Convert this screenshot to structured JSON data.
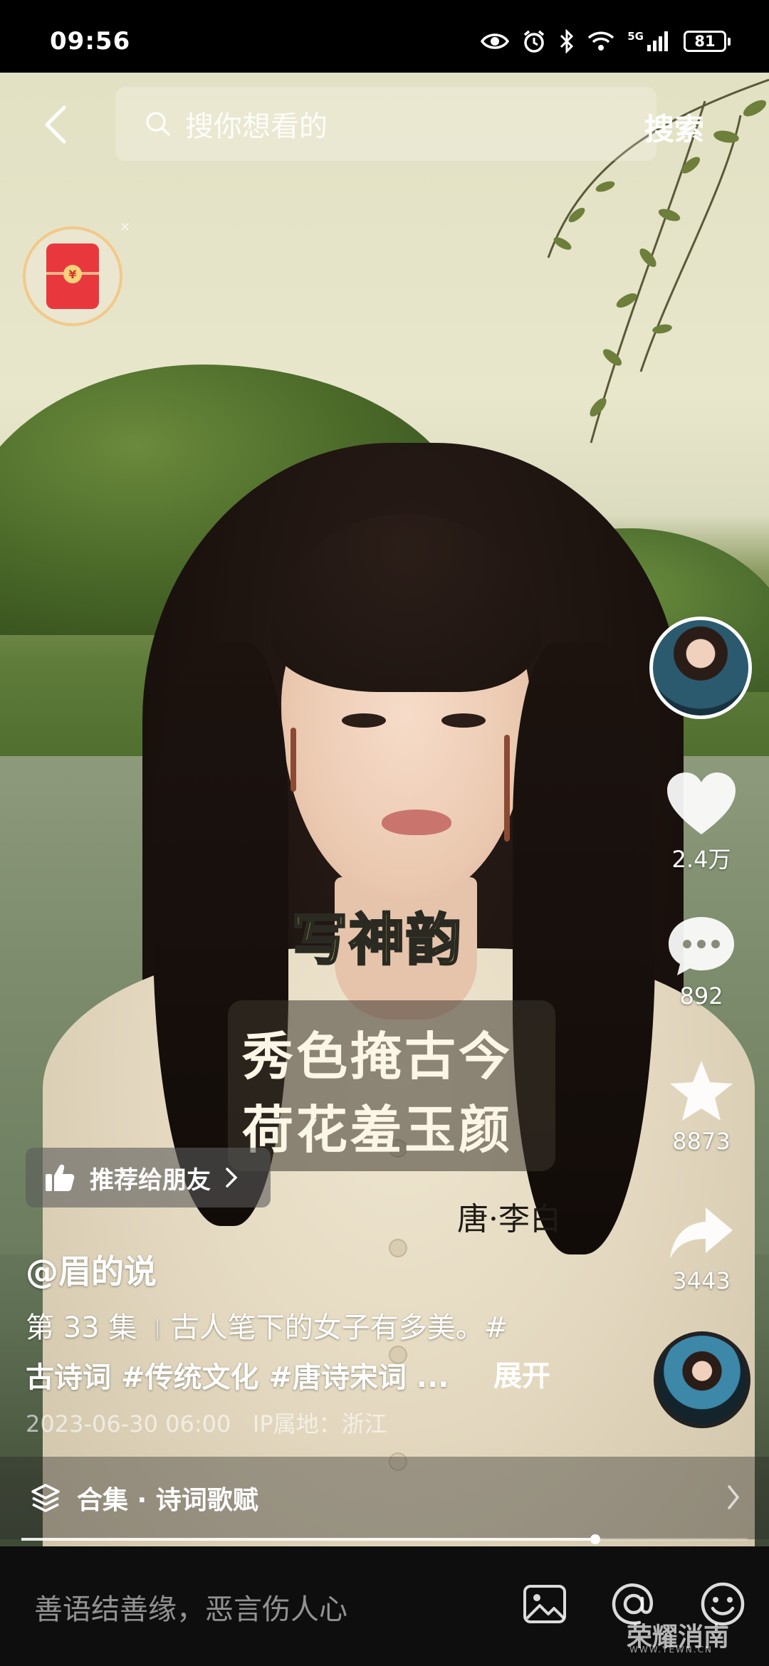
{
  "status_bar": {
    "time": "09:56",
    "network": "5G",
    "battery": "81"
  },
  "search": {
    "placeholder": "搜你想看的",
    "button_label": "搜索"
  },
  "red_packet": {
    "symbol": "¥",
    "close_symbol": "×"
  },
  "rail": {
    "like_count": "2.4万",
    "comment_count": "892",
    "favorite_count": "8873",
    "share_count": "3443"
  },
  "subtitles": {
    "keyword": "写神韵",
    "line1": "秀色掩古今",
    "line2": "荷花羞玉颜",
    "author": "唐·李白"
  },
  "recommend": {
    "label": "推荐给朋友"
  },
  "post": {
    "author": "@眉的说",
    "episode": "第 33 集",
    "separator": "|",
    "text": "古人笔下的女子有多美。#",
    "tags": "古诗词 #传统文化 #唐诗宋词 ...",
    "expand_label": "展开",
    "datetime": "2023-06-30 06:00",
    "ip_location": "IP属地：浙江"
  },
  "collection": {
    "label": "合集 · 诗词歌赋"
  },
  "playback": {
    "progress": 0.79
  },
  "comment_bar": {
    "placeholder": "善语结善缘，恶言伤人心"
  },
  "watermark": {
    "text": "荣耀消南",
    "sub": "WWW.YEWN.CN"
  },
  "icons": {
    "back": "chevron-left-icon",
    "search": "search-icon",
    "like": "heart-icon",
    "comment": "chat-bubble-icon",
    "favorite": "star-icon",
    "share": "share-arrow-icon",
    "collection": "layers-icon",
    "image": "image-icon",
    "mention": "at-icon",
    "emoji": "emoji-icon"
  }
}
